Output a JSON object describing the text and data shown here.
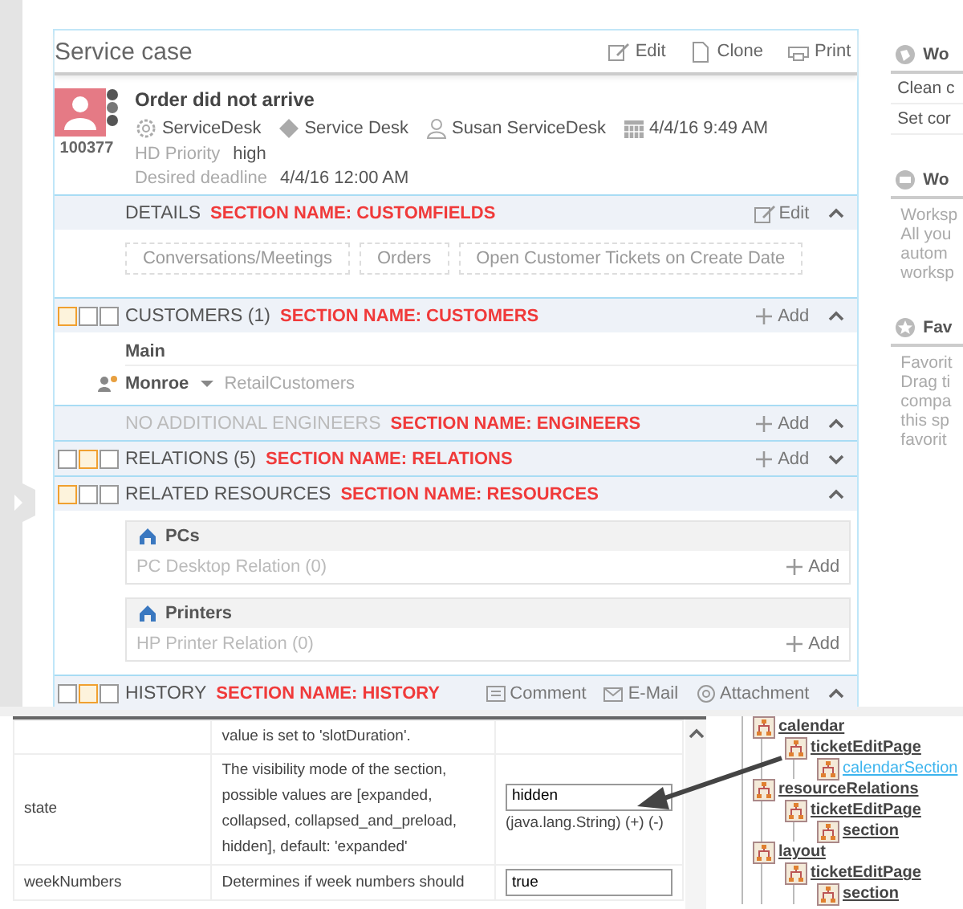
{
  "card": {
    "title": "Service case",
    "actions": [
      {
        "label": "Edit",
        "kind": "edit"
      },
      {
        "label": "Clone",
        "kind": "clone"
      },
      {
        "label": "Print",
        "kind": "print"
      }
    ]
  },
  "ticket": {
    "id": "100377",
    "title": "Order did not arrive",
    "meta": [
      "ServiceDesk",
      "Service Desk",
      "Susan ServiceDesk",
      "4/4/16 9:49 AM"
    ],
    "fields": [
      {
        "label": "HD Priority",
        "value": "high"
      },
      {
        "label": "Desired deadline",
        "value": "4/4/16 12:00 AM"
      }
    ]
  },
  "sections": [
    {
      "kind": "tabs",
      "title": "DETAILS",
      "annotation": "SECTION NAME: CUSTOMFIELDS",
      "empty": false,
      "expanded": true,
      "actions": [
        {
          "label": "Edit",
          "kind": "edit"
        }
      ],
      "tabs": [
        "Conversations/Meetings",
        "Orders",
        "Open Customer Tickets on Create Date"
      ]
    },
    {
      "kind": "customers",
      "title": "CUSTOMERS (1)",
      "annotation": "SECTION NAME: CUSTOMERS",
      "empty": false,
      "expanded": true,
      "layouts": [
        {
          "selected": true
        },
        {
          "selected": false
        },
        {
          "selected": false
        }
      ],
      "actions": [
        {
          "label": "Add",
          "kind": "add"
        }
      ],
      "group": "Main",
      "customer": "Monroe",
      "customer_type": "RetailCustomers"
    },
    {
      "title": "NO ADDITIONAL ENGINEERS",
      "annotation": "SECTION NAME: ENGINEERS",
      "empty": true,
      "expanded": true,
      "actions": [
        {
          "label": "Add",
          "kind": "add"
        }
      ]
    },
    {
      "title": "RELATIONS (5)",
      "annotation": "SECTION NAME: RELATIONS",
      "empty": false,
      "expanded": false,
      "layouts": [
        {
          "selected": false
        },
        {
          "selected": true
        },
        {
          "selected": false
        }
      ],
      "actions": [
        {
          "label": "Add",
          "kind": "add"
        }
      ]
    },
    {
      "kind": "resources",
      "title": "RELATED RESOURCES",
      "annotation": "SECTION NAME: RESOURCES",
      "empty": false,
      "expanded": true,
      "layouts": [
        {
          "selected": true
        },
        {
          "selected": false
        },
        {
          "selected": false
        }
      ],
      "groups": [
        {
          "title": "PCs",
          "relation": "PC Desktop Relation (0)",
          "action": "Add"
        },
        {
          "title": "Printers",
          "relation": "HP Printer Relation (0)",
          "action": "Add"
        }
      ]
    },
    {
      "title": "HISTORY",
      "annotation": "SECTION NAME: HISTORY",
      "empty": false,
      "expanded": true,
      "layouts": [
        {
          "selected": false
        },
        {
          "selected": true
        },
        {
          "selected": false
        }
      ],
      "actions": [
        {
          "label": "Comment",
          "kind": "comment"
        },
        {
          "label": "E-Mail",
          "kind": "mail"
        },
        {
          "label": "Attachment",
          "kind": "attachment"
        }
      ]
    }
  ],
  "sidebar": {
    "panels": [
      {
        "title": "Wo",
        "kind": "list",
        "lines": [
          "Clean c",
          "Set cor"
        ]
      },
      {
        "title": "Wo",
        "kind": "text",
        "lines": [
          "Worksp",
          "All you",
          "autom",
          "worksp"
        ]
      },
      {
        "title": "Fav",
        "kind": "text",
        "lines": [
          "Favorit",
          "Drag ti",
          "compa",
          "this sp",
          "favorit"
        ]
      }
    ]
  },
  "properties": {
    "rows": [
      {
        "name": "",
        "description": "value is set to 'slotDuration'."
      },
      {
        "name": "state",
        "description": "The visibility mode of the section, possible values are [expanded, collapsed, collapsed_and_preload, hidden], default: 'expanded'",
        "value": "hidden",
        "type": "(java.lang.String) (+) (-)"
      },
      {
        "name": "weekNumbers",
        "description": "Determines if week numbers should",
        "value": "true"
      }
    ]
  },
  "tree": [
    {
      "label": "calendar",
      "selected": false,
      "children": [
        {
          "label": "ticketEditPage",
          "selected": false,
          "children": [
            {
              "label": "calendarSection",
              "selected": true
            }
          ]
        }
      ]
    },
    {
      "label": "resourceRelations",
      "selected": false,
      "children": [
        {
          "label": "ticketEditPage",
          "selected": false,
          "children": [
            {
              "label": "section",
              "selected": false
            }
          ]
        }
      ]
    },
    {
      "label": "layout",
      "selected": false,
      "children": [
        {
          "label": "ticketEditPage",
          "selected": false,
          "children": [
            {
              "label": "section",
              "selected": false
            }
          ]
        }
      ]
    }
  ]
}
